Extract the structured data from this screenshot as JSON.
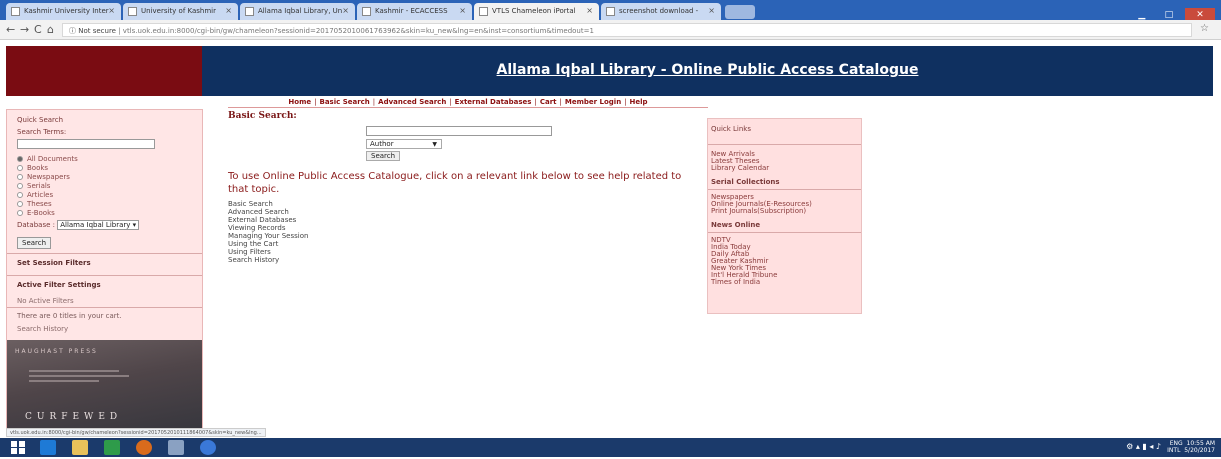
{
  "browser": {
    "tabs": [
      {
        "label": "Kashmir University Inter"
      },
      {
        "label": "University of Kashmir"
      },
      {
        "label": "Allama Iqbal Library, Un"
      },
      {
        "label": "Kashmir - ECACCESS"
      },
      {
        "label": "VTLS Chameleon iPortal"
      },
      {
        "label": "screenshot download - "
      }
    ],
    "nav": {
      "back": "←",
      "forward": "→",
      "reload": "C",
      "home": "⌂"
    },
    "not_secure": "ⓘ Not secure",
    "url": "vtls.uok.edu.in:8000/cgi-bin/gw/chameleon?sessionid=2017052010061763962&skin=ku_new&lng=en&inst=consortium&timedout=1",
    "star": "☆",
    "window": {
      "minimize": "▁",
      "maximize": "□",
      "close": "✕"
    }
  },
  "header": {
    "title": "Allama Iqbal Library - Online Public Access Catalogue"
  },
  "menu": {
    "items": [
      "Home",
      "Basic Search",
      "Advanced Search",
      "External Databases",
      "Cart",
      "Member Login",
      "Help"
    ],
    "separator": "|"
  },
  "sidebar": {
    "quick_search": "Quick Search",
    "search_terms": "Search Terms:",
    "radio_options": [
      "All Documents",
      "Books",
      "Newspapers",
      "Serials",
      "Articles",
      "Theses",
      "E-Books"
    ],
    "selected_radio": "All Documents",
    "database_label": "Database :",
    "database_value": "Allama Iqbal Library ▾",
    "search_button": "Search",
    "set_session_filters": "Set Session Filters",
    "active_filter_settings": "Active Filter Settings",
    "no_active_filters": "No Active Filters",
    "cart_text": "There are 0 titles in your cart.",
    "search_history": "Search History",
    "book": {
      "top": "HAUGHAST PRESS",
      "title": "CURFEWED"
    }
  },
  "main": {
    "heading": "Basic Search:",
    "search_type": "Author",
    "search_button": "Search",
    "help_intro": "To use Online Public Access Catalogue, click on a relevant link below to see help related to that topic.",
    "help_links": [
      "Basic Search",
      "Advanced Search",
      "External Databases",
      "Viewing Records",
      "Managing Your Session",
      "Using the Cart",
      "Using Filters",
      "Search History"
    ]
  },
  "quick_links": {
    "heading": "Quick Links",
    "group1": [
      "New Arrivals",
      "Latest Theses",
      "Library Calendar"
    ],
    "serial_collections": "Serial Collections",
    "group2": [
      "Newspapers",
      "Online Journals(E-Resources)",
      "Print Journals(Subscription)"
    ],
    "news_online": "News Online",
    "group3": [
      "NDTV",
      "India Today",
      "Daily Aftab",
      "Greater Kashmir",
      "New York Times",
      "Int'l Herald Tribune",
      "Times of India"
    ]
  },
  "status_bar": "vtls.uok.edu.in:8000/cgi-bin/gw/chameleon?sessionid=2017052010111864007&skin=ku_new&lng...",
  "taskbar": {
    "lang": "ENG",
    "intl": "INTL",
    "time": "10:55 AM",
    "date": "5/20/2017"
  },
  "colors": {
    "banner_left": "#7a0c12",
    "banner_right": "#0f3060",
    "sidebar_bg": "#ffe6e6",
    "accent_red": "#8b1010"
  }
}
